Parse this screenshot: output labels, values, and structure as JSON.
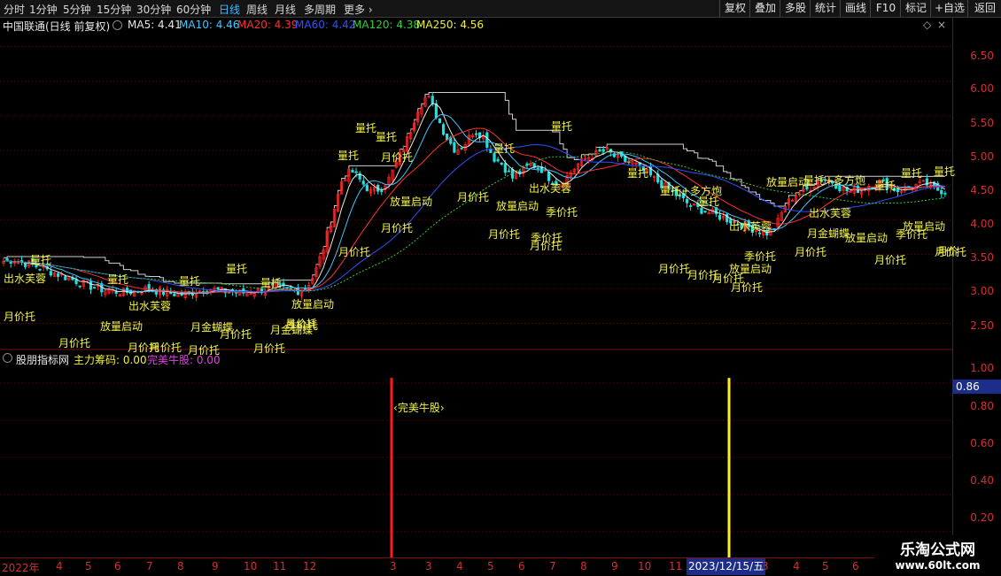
{
  "tabs": [
    "分时",
    "1分钟",
    "5分钟",
    "15分钟",
    "30分钟",
    "60分钟",
    "日线",
    "周线",
    "月线",
    "多周期",
    "更多"
  ],
  "active_tab": "日线",
  "right_buttons": [
    "复权",
    "叠加",
    "多股",
    "统计",
    "画线",
    "F10",
    "标记",
    "+自选",
    "返回"
  ],
  "header": {
    "stock": "中国联通(日线 前复权)",
    "ma5": "MA5: 4.41",
    "ma10": "MA10: 4.46",
    "ma20": "MA20: 4.39",
    "ma60": "MA60: 4.42",
    "ma120": "MA120: 4.38",
    "ma250": "MA250: 4.56"
  },
  "colors": {
    "ma5": "#e8e8e8",
    "ma10": "#3fc6ff",
    "ma20": "#ff3030",
    "ma60": "#3050ff",
    "ma120": "#30d030",
    "ma250": "#f0f030",
    "up": "#ff2020",
    "down": "#20e0e0",
    "signal": "#f2f24a",
    "grid": "#5a0a0a"
  },
  "price_ticks": [
    "6.50",
    "6.00",
    "5.50",
    "5.00",
    "4.50",
    "4.00",
    "3.50",
    "3.00",
    "2.50"
  ],
  "sub_indicator": {
    "name": "股朋指标网",
    "main": "主力筹码: 0.00",
    "perfect": "完美牛股: 0.00",
    "value_box": "0.86",
    "ticks": [
      "1.00",
      "0.80",
      "0.60",
      "0.40",
      "0.20"
    ],
    "bar_label": "完美牛股"
  },
  "dates": [
    "2022年",
    "4",
    "5",
    "6",
    "7",
    "8",
    "9",
    "10",
    "11",
    "12",
    "3",
    "3",
    "4",
    "5",
    "6",
    "7",
    "8",
    "9",
    "10",
    "11",
    "12",
    "2023/12/15/五",
    "3",
    "4",
    "5",
    "6"
  ],
  "watermark": {
    "line1": "乐淘公式网",
    "line2": "www.60lt.com"
  },
  "signals": [
    "量托",
    "出水芙蓉",
    "月价托",
    "月价托",
    "放量启动",
    "量托",
    "月价托",
    "月价托",
    "月价托",
    "出水芙蓉",
    "量托",
    "月金蝴蝶",
    "月价托",
    "月价托",
    "量托",
    "月价托",
    "量托",
    "放量启动",
    "季价托",
    "月金蝴蝶",
    "量托",
    "量托",
    "月价托",
    "月价托",
    "月价托",
    "放量启动",
    "量托",
    "月价托",
    "月价托",
    "量托",
    "季价托",
    "放量启动",
    "出水芙蓉",
    "季价托",
    "月价托",
    "量托",
    "量托+多方炮",
    "量托",
    "月价托",
    "月价托",
    "月价托",
    "月价托",
    "放量启动",
    "量托",
    "出水芙蓉",
    "季价托",
    "月价托",
    "放量启动",
    "量托+多方炮",
    "量托",
    "月金蝴蝶",
    "出水芙蓉",
    "放量启动",
    "季价托",
    "月价托",
    "量托",
    "量托",
    "月价托",
    "放量启动",
    "月价"
  ],
  "chart_data": {
    "type": "candlestick",
    "ylim": [
      2.2,
      6.7
    ],
    "ma_series": [
      "MA5",
      "MA10",
      "MA20",
      "MA60",
      "MA120",
      "MA250"
    ],
    "closes": [
      3.4,
      3.42,
      3.38,
      3.35,
      3.3,
      3.25,
      3.2,
      3.15,
      3.1,
      3.05,
      3.0,
      2.98,
      2.96,
      2.95,
      2.97,
      3.0,
      2.98,
      2.95,
      2.93,
      2.92,
      2.95,
      2.98,
      3.0,
      2.97,
      2.96,
      2.94,
      2.95,
      2.98,
      3.0,
      3.02,
      2.99,
      2.96,
      3.0,
      3.2,
      3.6,
      4.1,
      4.6,
      4.7,
      4.55,
      4.4,
      4.45,
      4.6,
      4.9,
      5.2,
      5.6,
      5.8,
      5.5,
      5.2,
      5.0,
      5.1,
      5.3,
      5.2,
      4.9,
      4.8,
      4.6,
      4.7,
      4.8,
      4.75,
      4.6,
      4.5,
      4.65,
      4.8,
      4.9,
      4.95,
      5.0,
      4.9,
      4.85,
      4.8,
      4.7,
      4.6,
      4.5,
      4.4,
      4.3,
      4.2,
      4.15,
      4.1,
      4.05,
      4.0,
      3.95,
      3.9,
      3.85,
      3.8,
      3.9,
      4.2,
      4.35,
      4.4,
      4.5,
      4.6,
      4.55,
      4.45,
      4.4,
      4.45,
      4.5,
      4.55,
      4.48,
      4.42,
      4.46,
      4.5,
      4.52,
      4.44,
      4.41
    ],
    "perfect_bars": [
      {
        "date_index": 10,
        "value": 1.0,
        "color": "red"
      },
      {
        "date_index": 22,
        "value": 1.0,
        "color": "yellow"
      }
    ]
  }
}
